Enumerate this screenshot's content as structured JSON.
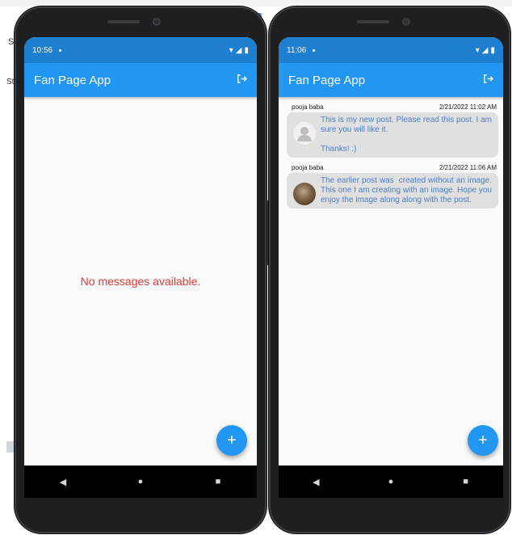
{
  "background": {
    "fragment_s": "S",
    "fragment_st": "St"
  },
  "phones": [
    {
      "status_time": "10:56",
      "app_title": "Fan Page App",
      "empty_message": "No messages available.",
      "fab_label": "+"
    },
    {
      "status_time": "11:06",
      "app_title": "Fan Page App",
      "fab_label": "+",
      "posts": [
        {
          "author": "pooja baba",
          "timestamp": "2/21/2022 11:02 AM",
          "text": "This is my new post. Please read this post. I am sure you will like it.\n\nThanks! :)",
          "avatar": "default-avatar"
        },
        {
          "author": "pooja baba",
          "timestamp": "2/21/2022 11:06 AM",
          "text": "The earlier post was  created without an image. This one I am creating with an image. Hope you enjoy the image along along with the post.",
          "avatar": "photo-avatar"
        }
      ]
    }
  ],
  "navbar": {
    "back": "◀",
    "home": "●",
    "recents": "■"
  },
  "colors": {
    "app_bar": "#2196f3",
    "status_bar": "#1e7fd1",
    "empty_message": "#e53935",
    "post_text": "#4a7fd1",
    "post_bubble": "#e0e0e0"
  },
  "icons": {
    "logout": "logout-icon",
    "wifi": "wifi-icon",
    "signal": "signal-icon",
    "battery": "battery-icon"
  }
}
